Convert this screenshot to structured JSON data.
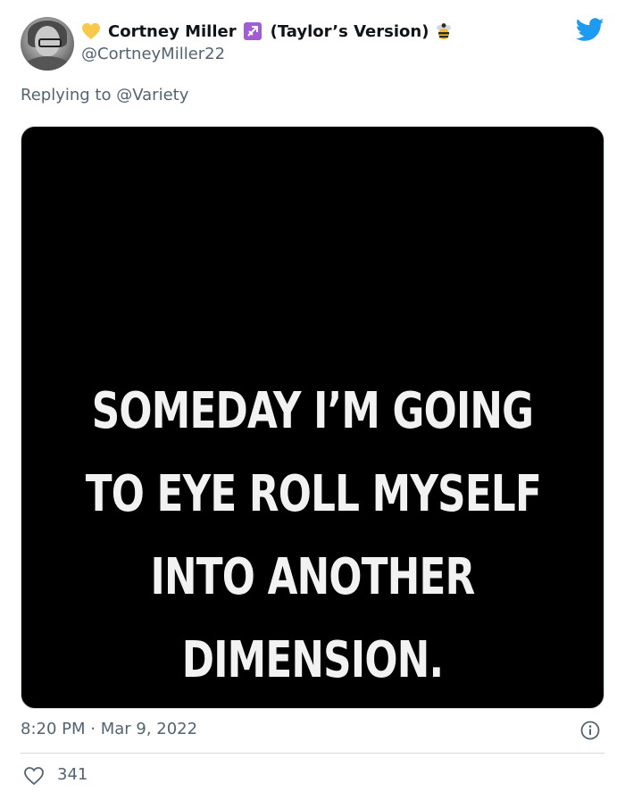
{
  "tweet": {
    "author": {
      "display_name": "Cortney Miller",
      "name_suffix": "(Taylor’s Version)",
      "handle": "@CortneyMiller22",
      "emoji_icons": [
        "yellow-heart-icon",
        "sagittarius-icon",
        "bee-icon"
      ]
    },
    "reply": {
      "prefix": "Replying to",
      "mention": "@Variety"
    },
    "media": {
      "lines": [
        "SOMEDAY I’M GOING",
        "TO EYE ROLL MYSELF",
        "INTO ANOTHER",
        "DIMENSION."
      ]
    },
    "timestamp": "8:20 PM · Mar 9, 2022",
    "likes": "341"
  },
  "colors": {
    "twitter_blue": "#1d9bf0",
    "secondary_text": "#536471",
    "primary_text": "#0f1419",
    "sagittarius_purple": "#a15dd4",
    "heart_yellow": "#f7c948"
  },
  "icons": {
    "brand": "twitter-bird-icon",
    "info": "info-icon",
    "like": "heart-outline-icon"
  }
}
